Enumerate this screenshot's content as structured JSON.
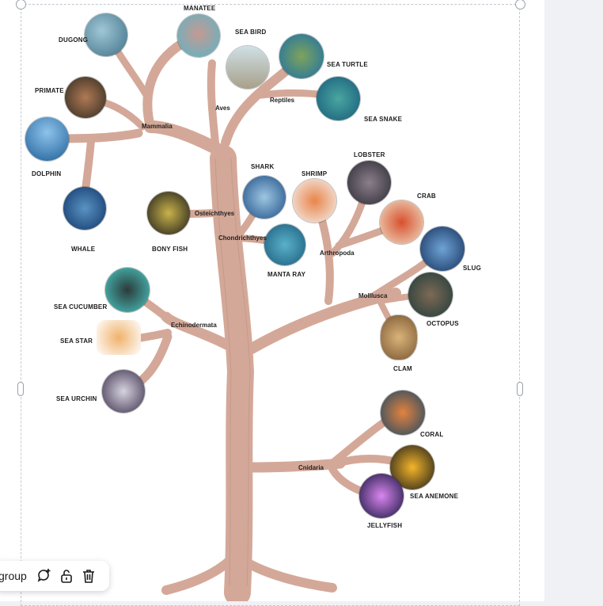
{
  "toolbar": {
    "group_label": "group"
  },
  "groups": {
    "mammalia": "Mammalia",
    "aves": "Aves",
    "reptiles": "Reptiles",
    "osteichthyes": "Osteichthyes",
    "chondrichthyes": "Chondrichthyes",
    "arthropoda": "Arthropoda",
    "mollusca": "Molllusca",
    "echinodermata": "Echinodermata",
    "cnidaria": "Cnidaria"
  },
  "animals": {
    "manatee": "MANATEE",
    "dugong": "DUGONG",
    "sea_bird": "SEA BIRD",
    "sea_turtle": "SEA TURTLE",
    "primate": "PRIMATE",
    "sea_snake": "SEA SNAKE",
    "dolphin": "DOLPHIN",
    "whale": "WHALE",
    "bony_fish": "BONY FISH",
    "shark": "SHARK",
    "shrimp": "SHRIMP",
    "lobster": "LOBSTER",
    "crab": "CRAB",
    "manta_ray": "MANTA RAY",
    "slug": "SLUG",
    "octopus": "OCTOPUS",
    "clam": "CLAM",
    "sea_cucumber": "SEA CUCUMBER",
    "sea_star": "SEA STAR",
    "sea_urchin": "SEA URCHIN",
    "coral": "CORAL",
    "sea_anemone": "SEA ANEMONE",
    "jellyfish": "JELLYFISH"
  },
  "colors": {
    "branch": "#d9aea0",
    "branch_edge": "#b98a7c",
    "canvas": "#ffffff",
    "pane": "#f0f1f5"
  }
}
